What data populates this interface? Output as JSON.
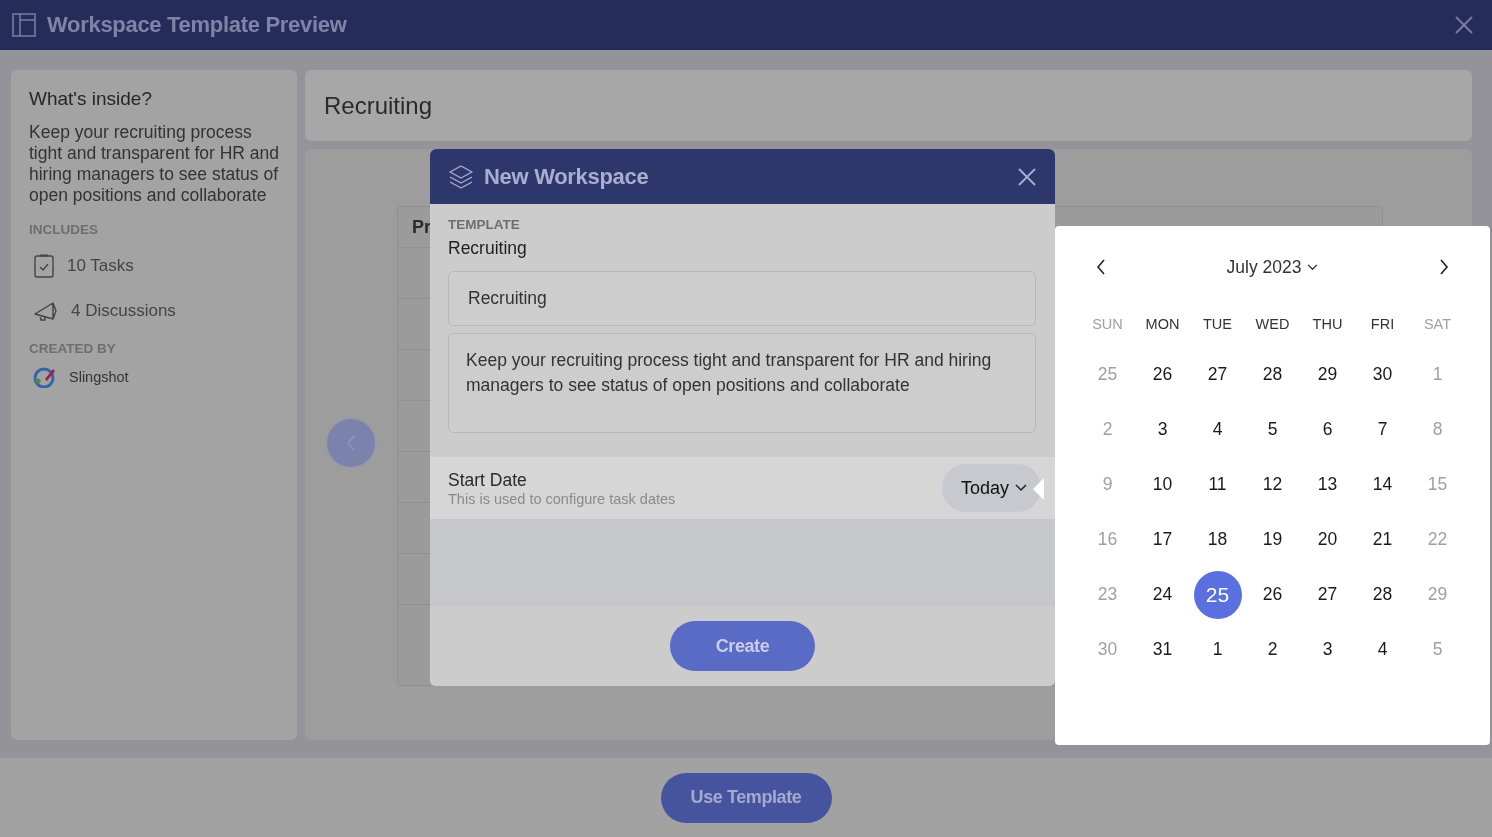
{
  "window": {
    "title": "Workspace Template Preview"
  },
  "sidebar": {
    "heading": "What's inside?",
    "description": "Keep your recruiting process tight and transparent for HR and hiring managers to see status of open positions and collaborate",
    "includes_label": "INCLUDES",
    "includes": [
      {
        "kind": "tasks",
        "label": "10 Tasks"
      },
      {
        "kind": "discussions",
        "label": "4 Discussions"
      }
    ],
    "created_by_label": "CREATED BY",
    "creator": "Slingshot"
  },
  "preview": {
    "title": "Recruiting",
    "table_header": "Pr"
  },
  "dialog": {
    "title": "New Workspace",
    "template_label": "TEMPLATE",
    "template_name": "Recruiting",
    "name_value": "Recruiting",
    "description_value": "Keep your recruiting process tight and transparent for HR and hiring managers to see status of open positions and collaborate",
    "start_date": {
      "label": "Start Date",
      "hint": "This is used to configure task dates",
      "value": "Today"
    },
    "create_button": "Create"
  },
  "calendar": {
    "month": "July 2023",
    "weekdays": [
      "SUN",
      "MON",
      "TUE",
      "WED",
      "THU",
      "FRI",
      "SAT"
    ],
    "weeks": [
      [
        {
          "day": "25",
          "selected": false
        },
        {
          "day": "26",
          "selected": false
        },
        {
          "day": "27",
          "selected": false
        },
        {
          "day": "28",
          "selected": false
        },
        {
          "day": "29",
          "selected": false
        },
        {
          "day": "30",
          "selected": false
        },
        {
          "day": "1",
          "selected": false
        }
      ],
      [
        {
          "day": "2",
          "selected": false
        },
        {
          "day": "3",
          "selected": false
        },
        {
          "day": "4",
          "selected": false
        },
        {
          "day": "5",
          "selected": false
        },
        {
          "day": "6",
          "selected": false
        },
        {
          "day": "7",
          "selected": false
        },
        {
          "day": "8",
          "selected": false
        }
      ],
      [
        {
          "day": "9",
          "selected": false
        },
        {
          "day": "10",
          "selected": false
        },
        {
          "day": "11",
          "selected": false
        },
        {
          "day": "12",
          "selected": false
        },
        {
          "day": "13",
          "selected": false
        },
        {
          "day": "14",
          "selected": false
        },
        {
          "day": "15",
          "selected": false
        }
      ],
      [
        {
          "day": "16",
          "selected": false
        },
        {
          "day": "17",
          "selected": false
        },
        {
          "day": "18",
          "selected": false
        },
        {
          "day": "19",
          "selected": false
        },
        {
          "day": "20",
          "selected": false
        },
        {
          "day": "21",
          "selected": false
        },
        {
          "day": "22",
          "selected": false
        }
      ],
      [
        {
          "day": "23",
          "selected": false
        },
        {
          "day": "24",
          "selected": false
        },
        {
          "day": "25",
          "selected": true
        },
        {
          "day": "26",
          "selected": false
        },
        {
          "day": "27",
          "selected": false
        },
        {
          "day": "28",
          "selected": false
        },
        {
          "day": "29",
          "selected": false
        }
      ],
      [
        {
          "day": "30",
          "selected": false
        },
        {
          "day": "31",
          "selected": false
        },
        {
          "day": "1",
          "selected": false
        },
        {
          "day": "2",
          "selected": false
        },
        {
          "day": "3",
          "selected": false
        },
        {
          "day": "4",
          "selected": false
        },
        {
          "day": "5",
          "selected": false
        }
      ]
    ]
  },
  "footer": {
    "button": "Use Template"
  }
}
